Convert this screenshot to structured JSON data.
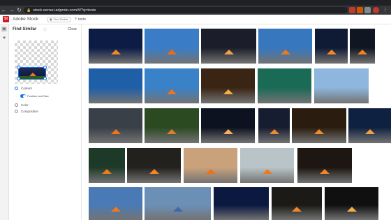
{
  "browser": {
    "url": "stock-sensei.adproto.com/#/?q=tents"
  },
  "app": {
    "logo_text": "St",
    "name": "Adobe Stock",
    "find_similar_button": "Find Similar",
    "search_query": "tents"
  },
  "panel": {
    "title": "Find Similar",
    "clear_label": "Clear",
    "options": {
      "content": "Content",
      "position_and_size": "Position and Size",
      "color": "Color",
      "composition": "Composition"
    },
    "selected_option": "Content",
    "position_and_size_enabled": true
  },
  "results": {
    "thumbnails": [
      {
        "id": 1,
        "bg": "#0c1c45",
        "tent": "#f08a22"
      },
      {
        "id": 2,
        "bg": "#3a7dc6",
        "tent": "#f06a12"
      },
      {
        "id": 3,
        "bg": "#1b1e2a",
        "tent": "#f0a04a"
      },
      {
        "id": 4,
        "bg": "#3777be",
        "tent": "#f07a1a"
      },
      {
        "id": 5,
        "bg": "#0f1a35",
        "tent": "#f28a2a"
      },
      {
        "id": 6,
        "bg": "#101622",
        "tent": "#f18222"
      },
      {
        "id": 7,
        "bg": "#1e5fa8",
        "tent": ""
      },
      {
        "id": 8,
        "bg": "#3a82c8",
        "tent": "#f0741c"
      },
      {
        "id": 9,
        "bg": "#3a2514",
        "tent": "#f7b040"
      },
      {
        "id": 10,
        "bg": "#1a6a56",
        "tent": ""
      },
      {
        "id": 11,
        "bg": "#8fb6dd",
        "tent": ""
      },
      {
        "id": 12,
        "bg": "#3a4048",
        "tent": "#f0751a"
      },
      {
        "id": 13,
        "bg": "#2b4a22",
        "tent": "#e37a2c"
      },
      {
        "id": 14,
        "bg": "#0d1220",
        "tent": "#f3b25a"
      },
      {
        "id": 15,
        "bg": "#171d30",
        "tent": "#f08a2a"
      },
      {
        "id": 16,
        "bg": "#2b1c10",
        "tent": "#f08a2a"
      },
      {
        "id": 17,
        "bg": "#0f2140",
        "tent": "#f3a040"
      },
      {
        "id": 18,
        "bg": "#1d3a28",
        "tent": "#f07a1c"
      },
      {
        "id": 19,
        "bg": "#23211e",
        "tent": "#f08828"
      },
      {
        "id": 20,
        "bg": "#c9a27c",
        "tent": "#f07018"
      },
      {
        "id": 21,
        "bg": "#b9c4c8",
        "tent": "#f07a1a"
      },
      {
        "id": 22,
        "bg": "#1d1612",
        "tent": "#f18428"
      },
      {
        "id": 23,
        "bg": "#4a7ab5",
        "tent": "#f07a1a"
      },
      {
        "id": 24,
        "bg": "#6c8fb5",
        "tent": "#3c6aa8"
      },
      {
        "id": 25,
        "bg": "#0b1840",
        "tent": ""
      },
      {
        "id": 26,
        "bg": "#1b1a16",
        "tent": "#f08828"
      },
      {
        "id": 27,
        "bg": "#101010",
        "tent": "#f3b040"
      }
    ]
  }
}
